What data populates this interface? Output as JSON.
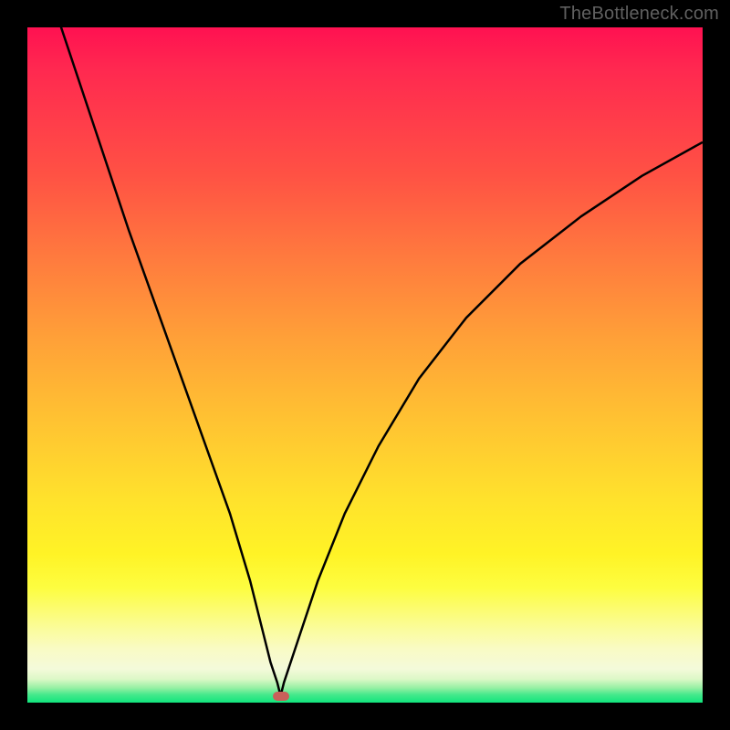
{
  "watermark": "TheBottleneck.com",
  "chart_data": {
    "type": "line",
    "title": "",
    "xlabel": "",
    "ylabel": "",
    "xlim": [
      0,
      100
    ],
    "ylim": [
      0,
      100
    ],
    "series": [
      {
        "name": "bottleneck-curve",
        "x": [
          0,
          5,
          10,
          15,
          20,
          25,
          30,
          33,
          35,
          36,
          37,
          37.5,
          38,
          40,
          43,
          47,
          52,
          58,
          65,
          73,
          82,
          91,
          100
        ],
        "values": [
          115,
          100,
          85,
          70,
          56,
          42,
          28,
          18,
          10,
          6,
          3,
          1,
          3,
          9,
          18,
          28,
          38,
          48,
          57,
          65,
          72,
          78,
          83
        ]
      }
    ],
    "marker": {
      "x": 37.5,
      "y": 0.9
    },
    "annotations": [],
    "legend": false,
    "grid": false
  },
  "colors": {
    "frame": "#000000",
    "curve": "#000000",
    "marker": "#c9605a",
    "watermark": "#606060"
  }
}
